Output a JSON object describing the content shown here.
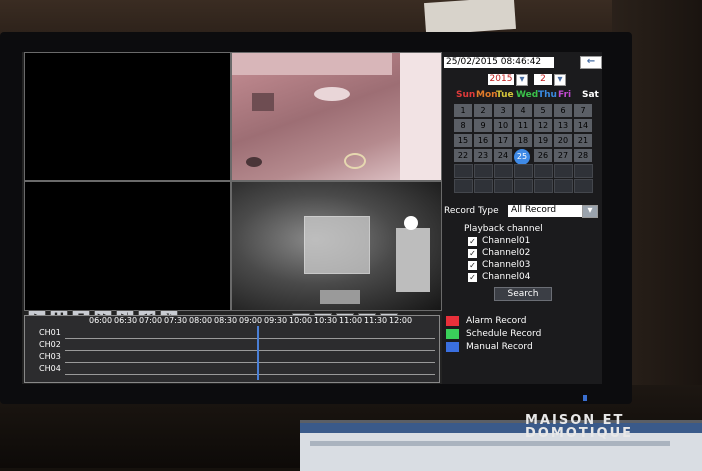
{
  "scene": {
    "watermark_line1": "MAISON ET",
    "watermark_line2": "DOMOTIQUE"
  },
  "header": {
    "datetime": "25/02/2015   08:46:42",
    "back_icon": "back-arrow-icon"
  },
  "calendar": {
    "year": "2015",
    "month": "2",
    "weekdays": [
      {
        "label": "Sun",
        "color": "#e03a3a"
      },
      {
        "label": "Mon",
        "color": "#e07a2a"
      },
      {
        "label": "Tue",
        "color": "#d4c43a"
      },
      {
        "label": "Wed",
        "color": "#3ac04a"
      },
      {
        "label": "Thu",
        "color": "#3a8ae0"
      },
      {
        "label": "Fri",
        "color": "#c04ad0"
      },
      {
        "label": "Sat",
        "color": "#ffffff"
      }
    ],
    "days": [
      "1",
      "2",
      "3",
      "4",
      "5",
      "6",
      "7",
      "8",
      "9",
      "10",
      "11",
      "12",
      "13",
      "14",
      "15",
      "16",
      "17",
      "18",
      "19",
      "20",
      "21",
      "22",
      "23",
      "24",
      "25",
      "26",
      "27",
      "28"
    ],
    "selected_day": "25"
  },
  "search": {
    "record_type_label": "Record Type",
    "record_type_value": "All Record",
    "playback_channel_label": "Playback channel",
    "channels": [
      {
        "label": "Channel01",
        "checked": true
      },
      {
        "label": "Channel02",
        "checked": true
      },
      {
        "label": "Channel03",
        "checked": true
      },
      {
        "label": "Channel04",
        "checked": true
      }
    ],
    "search_button": "Search"
  },
  "legend": [
    {
      "label": "Alarm Record",
      "color": "#e8303a"
    },
    {
      "label": "Schedule Record",
      "color": "#3ad05a"
    },
    {
      "label": "Manual Record",
      "color": "#3a6fe0"
    }
  ],
  "timeline": {
    "hours": [
      "06:00",
      "06:30",
      "07:00",
      "07:30",
      "08:00",
      "08:30",
      "09:00",
      "09:30",
      "10:00",
      "10:30",
      "11:00",
      "11:30",
      "12:00"
    ],
    "channels": [
      "CH01",
      "CH02",
      "CH03",
      "CH04"
    ],
    "cursor_fraction": 0.52
  },
  "playback_controls": [
    "play-icon",
    "pause-icon",
    "stop-icon",
    "fast-forward-icon",
    "step-forward-icon",
    "rewind-icon",
    "loop-icon"
  ],
  "view_controls": [
    "zoom-icon",
    "previous-segment-icon",
    "next-segment-icon",
    "zoom-out-icon",
    "fullscreen-icon"
  ]
}
